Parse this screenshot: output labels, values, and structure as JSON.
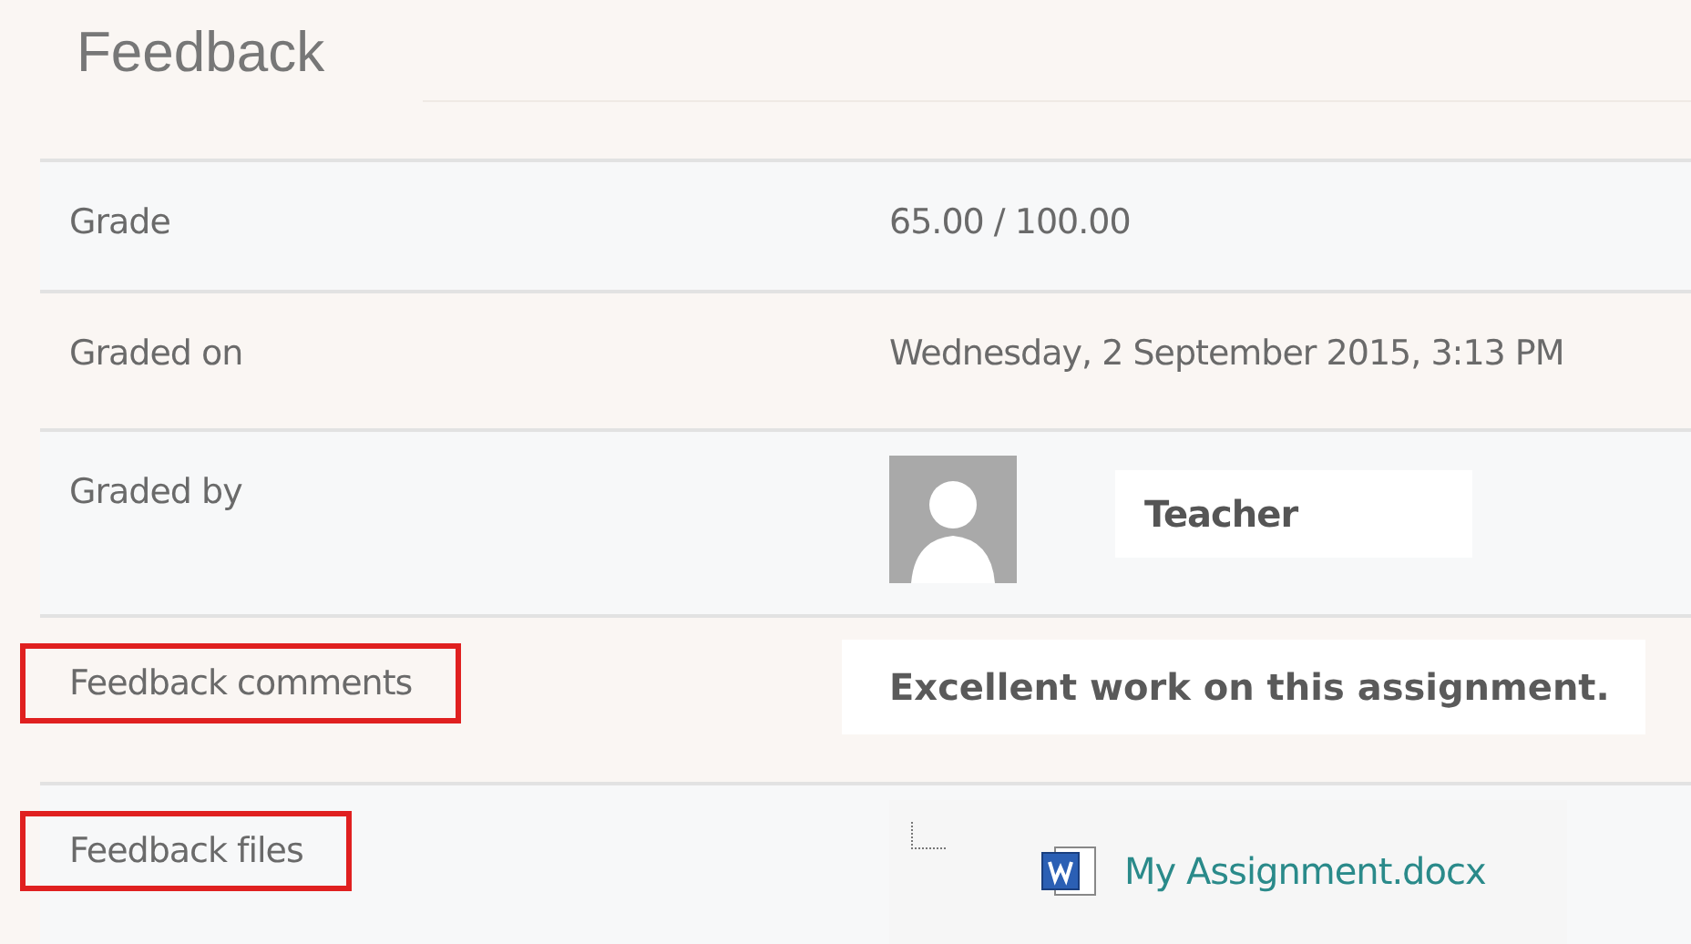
{
  "title": "Feedback",
  "rows": [
    {
      "label": "Grade",
      "kind": "text",
      "value": "65.00 / 100.00",
      "highlighted": false
    },
    {
      "label": "Graded on",
      "kind": "text",
      "value": "Wednesday, 2 September 2015, 3:13 PM",
      "highlighted": false
    },
    {
      "label": "Graded by",
      "kind": "user",
      "value": "Teacher",
      "highlighted": false
    },
    {
      "label": "Feedback comments",
      "kind": "comment",
      "value": "Excellent work on this assignment.",
      "highlighted": true
    },
    {
      "label": "Feedback files",
      "kind": "file",
      "value": "My Assignment.docx",
      "highlighted": true
    }
  ]
}
